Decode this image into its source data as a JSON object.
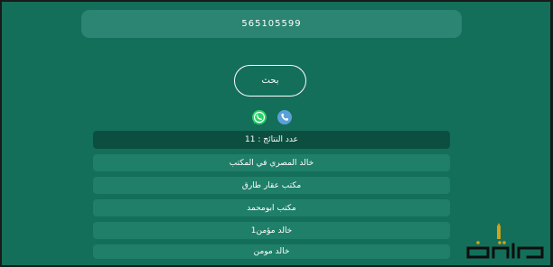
{
  "search": {
    "value": "565105599"
  },
  "search_button": {
    "label": "بحث"
  },
  "icons": {
    "whatsapp": "whatsapp-icon",
    "phone": "phone-icon"
  },
  "results": {
    "count_label": "عدد النتائج : 11",
    "items": [
      {
        "label": "خالد المصري في المكتب"
      },
      {
        "label": "مكتب عقار طارق"
      },
      {
        "label": "مكتب ابومحمد"
      },
      {
        "label": "خالد مؤمن1"
      },
      {
        "label": "خالد مومن"
      }
    ]
  },
  "colors": {
    "background": "#146f5a",
    "field": "#2c8572",
    "count_bar": "#0c4f40",
    "item": "#1f7f69",
    "whatsapp": "#25d366",
    "phone": "#5aa0d8"
  },
  "logo": {
    "text": "منارة"
  }
}
